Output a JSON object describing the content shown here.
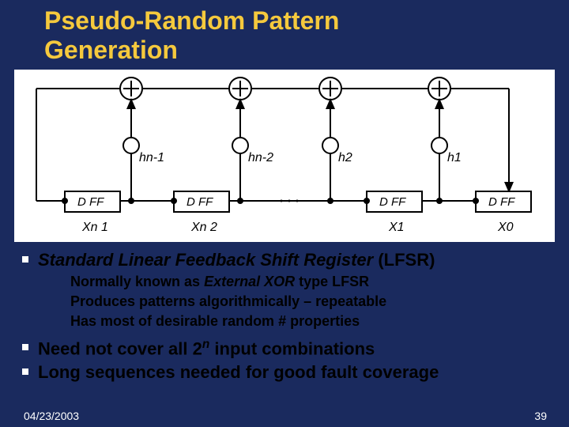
{
  "title_line1": "Pseudo-Random Pattern",
  "title_line2": "Generation",
  "diagram": {
    "tap_labels": [
      "hn-1",
      "hn-2",
      "h2",
      "h1"
    ],
    "ff_label": "D FF",
    "outputs": [
      "Xn 1",
      "Xn 2",
      "X1",
      "X0"
    ]
  },
  "bullets": {
    "b1_prefix": "Standard Linear Feedback Shift Register",
    "b1_suffix": " (LFSR)",
    "s1_prefix": "Normally known as ",
    "s1_italic": "External XOR",
    "s1_suffix": " type LFSR",
    "s2": "Produces patterns algorithmically – repeatable",
    "s3": "Has most of desirable random # properties",
    "b2_prefix": "Need not cover all ",
    "b2_two": "2",
    "b2_n": "n",
    "b2_suffix": " input combinations",
    "b3": "Long sequences needed for good fault coverage"
  },
  "footer": {
    "date": "04/23/2003",
    "page": "39"
  }
}
